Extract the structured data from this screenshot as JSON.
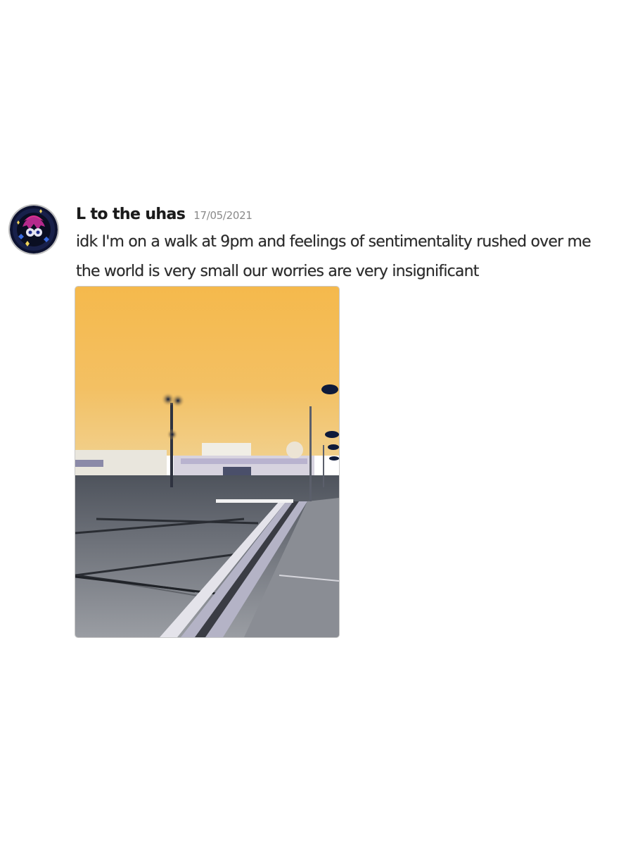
{
  "message": {
    "author": "L to the uhas",
    "timestamp": "17/05/2021",
    "lines": [
      "idk I'm on a walk at 9pm and feelings of sentimentality rushed over me",
      "the world is very small our worries are very insignificant"
    ],
    "attachment": {
      "type": "image",
      "subject": "inverted-color photo of an empty parking lot at night"
    }
  },
  "colors": {
    "username": "#1a1a1a",
    "timestamp": "#8a8a8a",
    "text": "#2a2a2a",
    "sky": "#f3bd55",
    "pavement": "#7d8086"
  }
}
